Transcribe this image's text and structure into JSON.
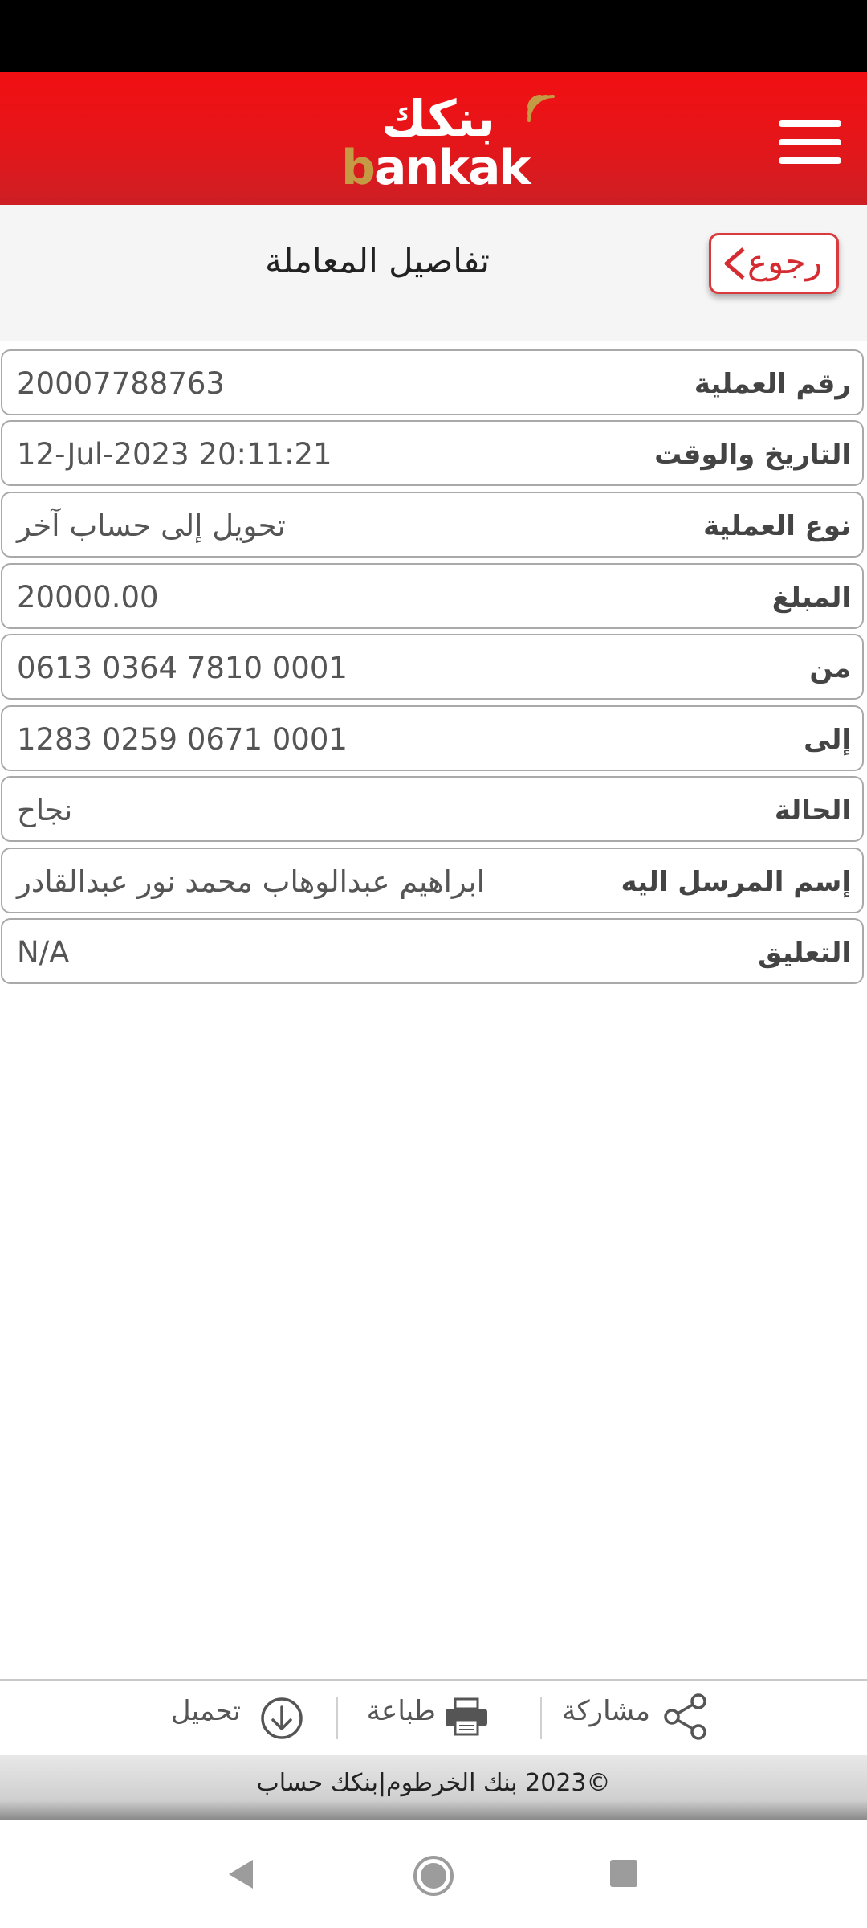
{
  "header": {
    "logo_ar": "بنكك",
    "logo_en_first": "b",
    "logo_en_rest": "ankak",
    "menu_icon": "hamburger-menu-icon"
  },
  "titlebar": {
    "back_label": "رجوع",
    "title": "تفاصيل المعاملة"
  },
  "details": [
    {
      "label": "رقم العملية",
      "value": "20007788763"
    },
    {
      "label": "التاريخ والوقت",
      "value": "12-Jul-2023 20:11:21"
    },
    {
      "label": "نوع العملية",
      "value": "تحويل إلى حساب آخر"
    },
    {
      "label": "المبلغ",
      "value": "20000.00"
    },
    {
      "label": "من",
      "value": "0613 0364 7810 0001"
    },
    {
      "label": "إلى",
      "value": "1283 0259 0671 0001"
    },
    {
      "label": "الحالة",
      "value": "نجاح"
    },
    {
      "label": "إسم المرسل اليه",
      "value": "ابراهيم عبدالوهاب محمد نور عبدالقادر"
    },
    {
      "label": "التعليق",
      "value": "N/A"
    }
  ],
  "actions": {
    "share": "مشاركة",
    "print": "طباعة",
    "download": "تحميل"
  },
  "footer": {
    "copyright": "©2023 بنك الخرطوم|بنكك حساب"
  },
  "colors": {
    "brand_red": "#e4161a",
    "brand_gold": "#c49a45"
  }
}
